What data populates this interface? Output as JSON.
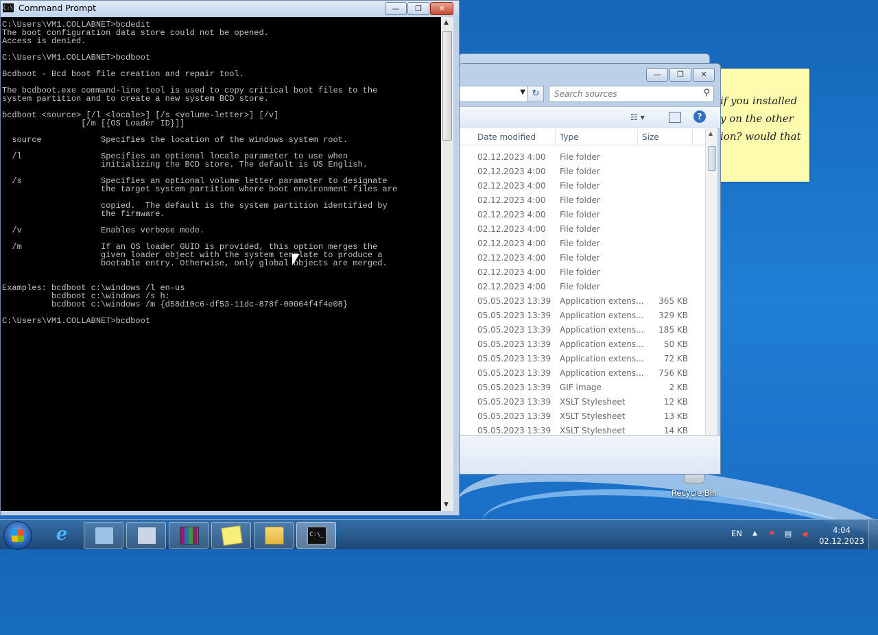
{
  "desktop": {
    "recycle_bin_label": "Recycle Bin",
    "sticky_note_lines": [
      "if you installed",
      "y on the other",
      "ion? would that"
    ]
  },
  "cmd_window": {
    "title": "Command Prompt",
    "title_icon": "C:\\",
    "controls": {
      "minimize": "—",
      "maximize": "❐",
      "close": "✕"
    },
    "console_lines": [
      "C:\\Users\\VM1.COLLABNET>bcdedit",
      "The boot configuration data store could not be opened.",
      "Access is denied.",
      "",
      "C:\\Users\\VM1.COLLABNET>bcdboot",
      "",
      "Bcdboot - Bcd boot file creation and repair tool.",
      "",
      "The bcdboot.exe command-line tool is used to copy critical boot files to the",
      "system partition and to create a new system BCD store.",
      "",
      "bcdboot <source> [/l <locale>] [/s <volume-letter>] [/v]",
      "                [/m [{OS Loader ID}]]",
      "",
      "  source            Specifies the location of the windows system root.",
      "",
      "  /l                Specifies an optional locale parameter to use when",
      "                    initializing the BCD store. The default is US English.",
      "",
      "  /s                Specifies an optional volume letter parameter to designate",
      "                    the target system partition where boot environment files are",
      "",
      "                    copied.  The default is the system partition identified by",
      "                    the firmware.",
      "",
      "  /v                Enables verbose mode.",
      "",
      "  /m                If an OS loader GUID is provided, this option merges the",
      "                    given loader object with the system template to produce a",
      "                    bootable entry. Otherwise, only global objects are merged.",
      "",
      "",
      "Examples: bcdboot c:\\windows /l en-us",
      "          bcdboot c:\\windows /s h:",
      "          bcdboot c:\\windows /m {d58d10c6-df53-11dc-878f-00064f4f4e08}",
      "",
      "C:\\Users\\VM1.COLLABNET>bcdboot"
    ]
  },
  "explorer": {
    "controls": {
      "minimize": "—",
      "maximize": "❐",
      "close": "✕"
    },
    "search_placeholder": "Search sources",
    "columns": {
      "date": "Date modified",
      "type": "Type",
      "size": "Size"
    },
    "rows": [
      {
        "date": "02.12.2023 4:00",
        "type": "File folder",
        "size": ""
      },
      {
        "date": "02.12.2023 4:00",
        "type": "File folder",
        "size": ""
      },
      {
        "date": "02.12.2023 4:00",
        "type": "File folder",
        "size": ""
      },
      {
        "date": "02.12.2023 4:00",
        "type": "File folder",
        "size": ""
      },
      {
        "date": "02.12.2023 4:00",
        "type": "File folder",
        "size": ""
      },
      {
        "date": "02.12.2023 4:00",
        "type": "File folder",
        "size": ""
      },
      {
        "date": "02.12.2023 4:00",
        "type": "File folder",
        "size": ""
      },
      {
        "date": "02.12.2023 4:00",
        "type": "File folder",
        "size": ""
      },
      {
        "date": "02.12.2023 4:00",
        "type": "File folder",
        "size": ""
      },
      {
        "date": "02.12.2023 4:00",
        "type": "File folder",
        "size": ""
      },
      {
        "date": "05.05.2023 13:39",
        "type": "Application extens...",
        "size": "365 KB"
      },
      {
        "date": "05.05.2023 13:39",
        "type": "Application extens...",
        "size": "329 KB"
      },
      {
        "date": "05.05.2023 13:39",
        "type": "Application extens...",
        "size": "185 KB"
      },
      {
        "date": "05.05.2023 13:39",
        "type": "Application extens...",
        "size": "50 KB"
      },
      {
        "date": "05.05.2023 13:39",
        "type": "Application extens...",
        "size": "72 KB"
      },
      {
        "date": "05.05.2023 13:39",
        "type": "Application extens...",
        "size": "756 KB"
      },
      {
        "date": "05.05.2023 13:39",
        "type": "GIF image",
        "size": "2 KB"
      },
      {
        "date": "05.05.2023 13:39",
        "type": "XSLT Stylesheet",
        "size": "12 KB"
      },
      {
        "date": "05.05.2023 13:39",
        "type": "XSLT Stylesheet",
        "size": "13 KB"
      },
      {
        "date": "05.05.2023 13:39",
        "type": "XSLT Stylesheet",
        "size": "14 KB"
      }
    ]
  },
  "taskbar": {
    "items": [
      {
        "name": "taskbar-internet-explorer",
        "icon": "ie-icon",
        "glyph": "e",
        "state": "pinned"
      },
      {
        "name": "taskbar-server-manager",
        "icon": "server-manager-icon",
        "glyph": "",
        "state": "open"
      },
      {
        "name": "taskbar-computer",
        "icon": "computer-icon",
        "glyph": "",
        "state": "open"
      },
      {
        "name": "taskbar-winrar",
        "icon": "winrar-icon",
        "glyph": "",
        "state": "open"
      },
      {
        "name": "taskbar-sticky-notes",
        "icon": "sticky-notes-icon",
        "glyph": "",
        "state": "open"
      },
      {
        "name": "taskbar-explorer",
        "icon": "folder-icon",
        "glyph": "",
        "state": "open"
      },
      {
        "name": "taskbar-command-prompt",
        "icon": "cmd-icon",
        "glyph": "C:\\_",
        "state": "active"
      }
    ],
    "language": "EN",
    "clock_time": "4:04",
    "clock_date": "02.12.2023"
  }
}
